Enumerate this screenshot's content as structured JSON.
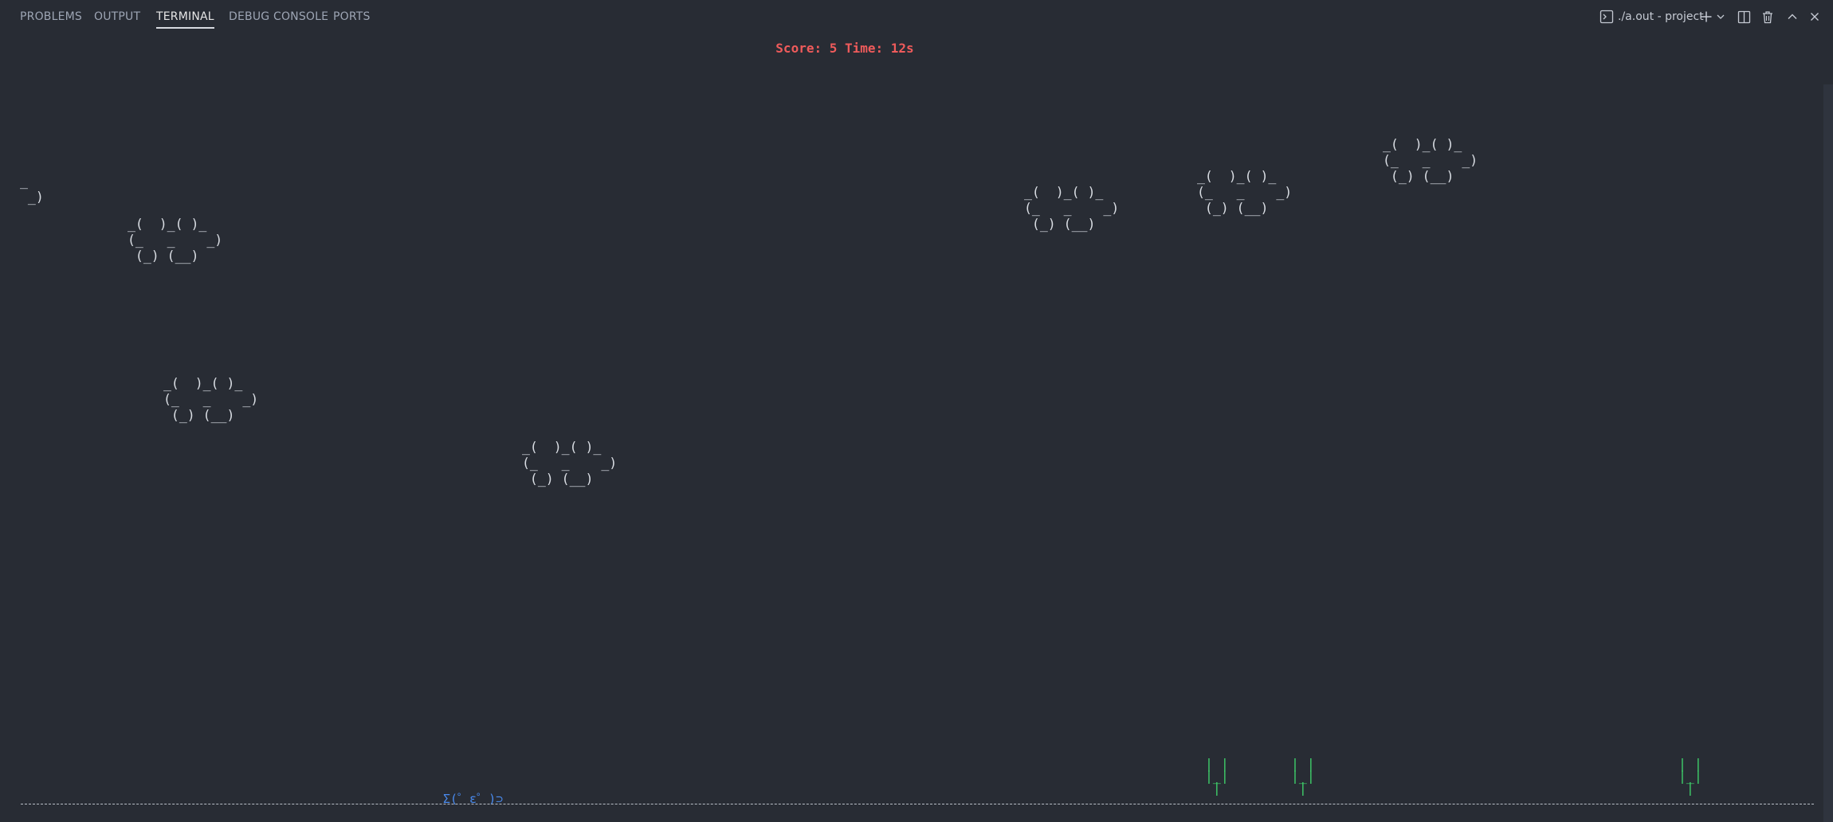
{
  "tabs": [
    {
      "label": "PROBLEMS",
      "active": false
    },
    {
      "label": "OUTPUT",
      "active": false
    },
    {
      "label": "TERMINAL",
      "active": true
    },
    {
      "label": "DEBUG CONSOLE",
      "active": false
    },
    {
      "label": "PORTS",
      "active": false
    }
  ],
  "toolbar": {
    "terminal_label": "./a.out - project",
    "icons": [
      "terminal-icon",
      "plus-icon",
      "chevron-down-icon",
      "split-icon",
      "trash-icon",
      "chevron-up-icon",
      "close-icon"
    ]
  },
  "game": {
    "status": "Score: 5 Time: 12s",
    "clouds": [
      "_(  )_( )_\n(_   _    _)\n (_) (__)",
      "_(  )_( )_\n(_   _    _)\n (_) (__)",
      "_(  )_( )_\n(_   _    _)\n (_) (__)",
      "_(  )_( )_\n(_   _    _)\n (_) (__)",
      "_(  )_( )_\n(_   _    _)\n (_) (__)",
      "_(  )_( )_\n(_   _    _)\n (_) (__)"
    ],
    "partial_cloud": "_\n _)",
    "player": "Σ(゜ε゜)⊃",
    "cacti": [
      "| |\n|_|\n |",
      "| |\n|_|\n |",
      "| |\n|_|\n |"
    ]
  },
  "colors": {
    "background": "#282c34",
    "score": "#ef5b5b",
    "cactus": "#3ecf6a",
    "player": "#4a8cf0",
    "cloud": "#d9dde3"
  }
}
